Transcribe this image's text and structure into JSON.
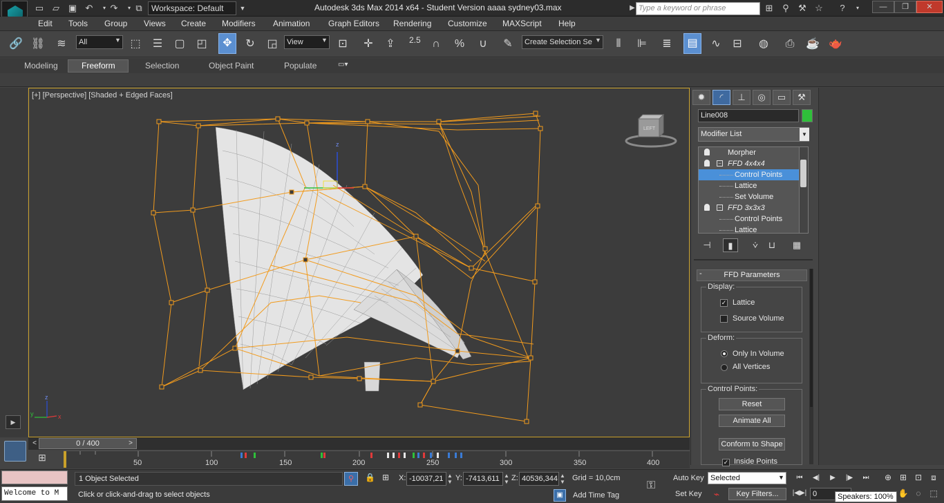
{
  "titlebar": {
    "workspace": "Workspace: Default",
    "title": "Autodesk 3ds Max  2014 x64  - Student Version    aaaa sydney03.max",
    "search_placeholder": "Type a keyword or phrase"
  },
  "menu": [
    "Edit",
    "Tools",
    "Group",
    "Views",
    "Create",
    "Modifiers",
    "Animation",
    "Graph Editors",
    "Rendering",
    "Customize",
    "MAXScript",
    "Help"
  ],
  "toolbar": {
    "filter": "All",
    "ref_coord": "View",
    "snap_angle": "2.5",
    "named_sel": "Create Selection Se"
  },
  "ribbon": {
    "tabs": [
      "Modeling",
      "Freeform",
      "Selection",
      "Object Paint",
      "Populate"
    ],
    "active": "Freeform"
  },
  "viewport": {
    "label": "[+] [Perspective] [Shaded + Edged Faces]",
    "viewcube_face": "LEFT",
    "axis": {
      "x": "x",
      "y": "y",
      "z": "z"
    },
    "border_color": "#c9a02a",
    "lattice_color": "#f29b1d",
    "mesh_color": "#e8e8e8"
  },
  "command_panel": {
    "object_name": "Line008",
    "object_color": "#2fbf3a",
    "modifier_list": "Modifier List",
    "stack": [
      {
        "label": "Morpher",
        "kind": "modifier",
        "italic": false
      },
      {
        "label": "FFD 4x4x4",
        "kind": "modifier",
        "italic": true
      },
      {
        "label": "Control Points",
        "kind": "sub",
        "selected": true
      },
      {
        "label": "Lattice",
        "kind": "sub"
      },
      {
        "label": "Set Volume",
        "kind": "sub"
      },
      {
        "label": "FFD 3x3x3",
        "kind": "modifier",
        "italic": true
      },
      {
        "label": "Control Points",
        "kind": "sub"
      },
      {
        "label": "Lattice",
        "kind": "sub"
      }
    ],
    "rollout": {
      "title": "FFD Parameters",
      "minus": "-",
      "display_title": "Display:",
      "lattice": "Lattice",
      "lattice_checked": true,
      "source_volume": "Source Volume",
      "source_volume_checked": false,
      "deform_title": "Deform:",
      "only_in_volume": "Only In Volume",
      "all_vertices": "All Vertices",
      "deform_selected": "Only In Volume",
      "control_points_title": "Control Points:",
      "reset": "Reset",
      "animate_all": "Animate All",
      "conform": "Conform to Shape",
      "inside_points": "Inside Points"
    }
  },
  "timeline": {
    "slider": "0 / 400",
    "ticks": [
      "50",
      "100",
      "150",
      "200",
      "250",
      "300",
      "350",
      "400"
    ]
  },
  "status": {
    "maxscript": "Welcome to M",
    "selection": "1 Object Selected",
    "prompt": "Click or click-and-drag to select objects",
    "x_label": "X:",
    "x": "-10037,21",
    "y_label": "Y:",
    "y": "-7413,611",
    "z_label": "Z:",
    "z": "40536,344",
    "grid": "Grid = 10,0cm",
    "add_time_tag": "Add Time Tag",
    "auto_key": "Auto Key",
    "set_key": "Set Key",
    "key_mode": "Selected",
    "key_filters": "Key Filters...",
    "frame": "0",
    "speakers": "Speakers: 100%"
  }
}
